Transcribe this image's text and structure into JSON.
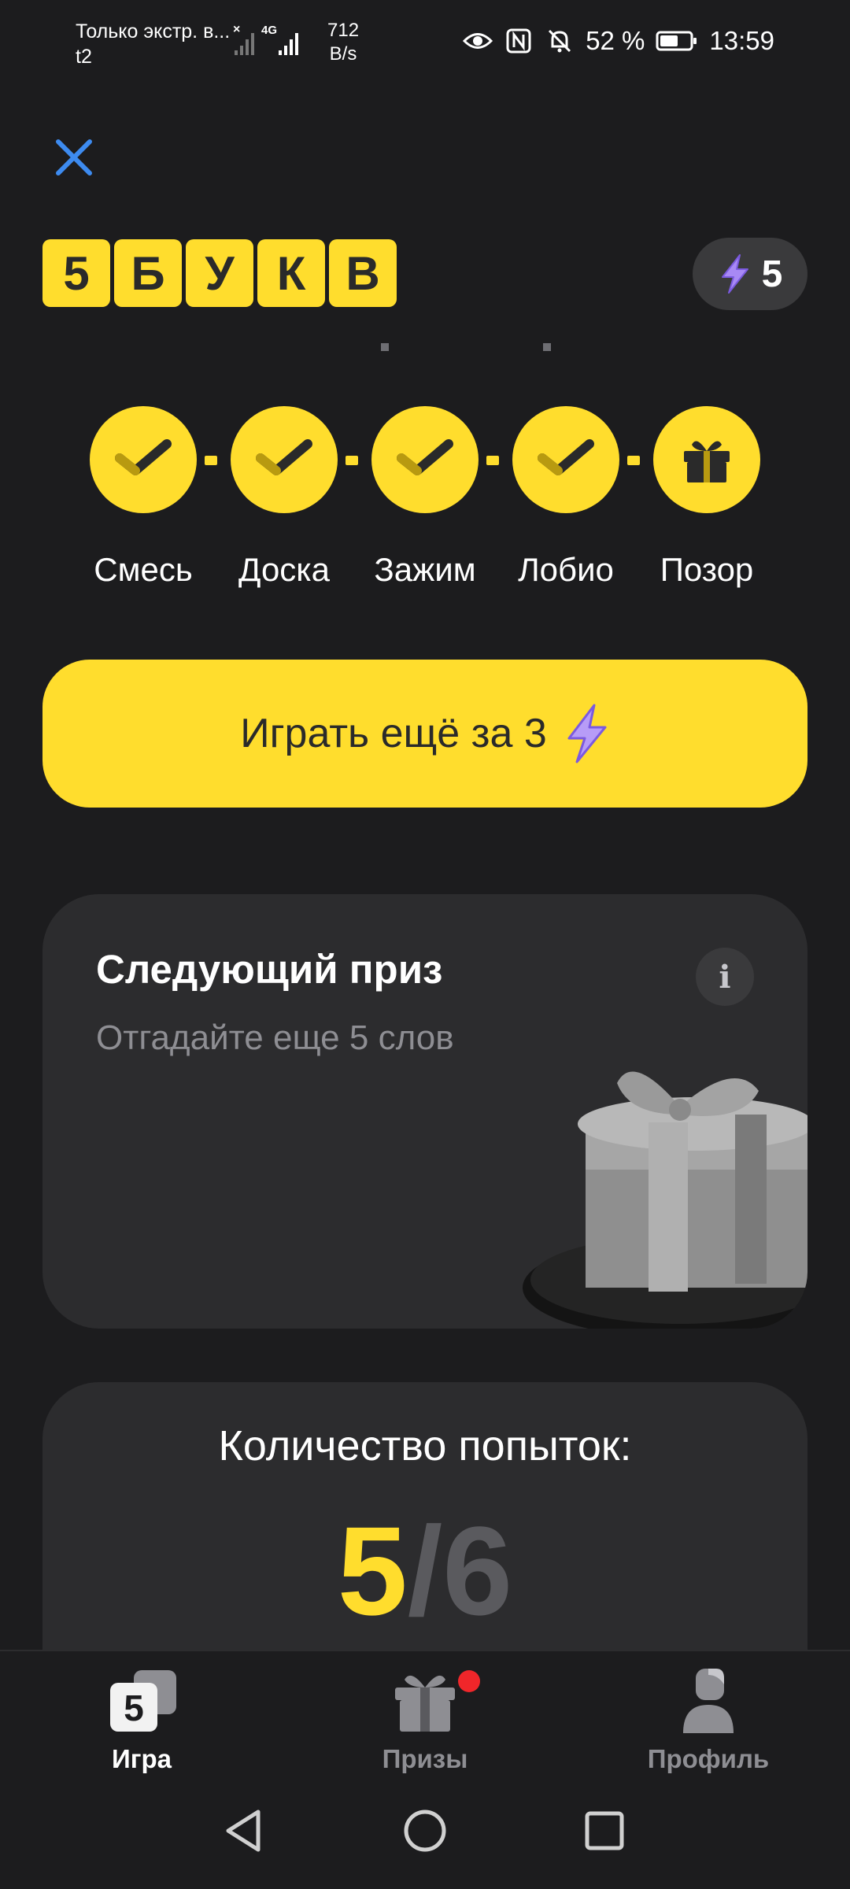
{
  "status_bar": {
    "carrier_line1": "Только экстр. в...",
    "carrier_line2": "t2",
    "network": "4G",
    "speed_value": "712",
    "speed_unit": "B/s",
    "battery": "52 %",
    "time": "13:59",
    "icons": [
      "eye-icon",
      "nfc-icon",
      "bell-off-icon",
      "battery-icon"
    ]
  },
  "header": {
    "logo_letters": [
      "5",
      "Б",
      "У",
      "К",
      "В"
    ],
    "energy_count": "5"
  },
  "progress": {
    "steps": [
      {
        "label": "Смесь",
        "icon": "check-icon",
        "done": true
      },
      {
        "label": "Доска",
        "icon": "check-icon",
        "done": true
      },
      {
        "label": "Зажим",
        "icon": "check-icon",
        "done": true
      },
      {
        "label": "Лобио",
        "icon": "check-icon",
        "done": true
      },
      {
        "label": "Позор",
        "icon": "gift-icon",
        "done": true
      }
    ]
  },
  "play_button": {
    "label": "Играть ещё за 3",
    "icon": "lightning-icon"
  },
  "prize_card": {
    "title": "Следующий приз",
    "subtitle": "Отгадайте еще 5 слов",
    "info_glyph": "i"
  },
  "attempts_card": {
    "title": "Количество попыток:",
    "current": "5",
    "separator": "/",
    "max": "6"
  },
  "bottom_nav": {
    "items": [
      {
        "label": "Игра",
        "icon": "game-icon",
        "active": true
      },
      {
        "label": "Призы",
        "icon": "gift-icon",
        "active": false,
        "badge": true
      },
      {
        "label": "Профиль",
        "icon": "profile-icon",
        "active": false
      }
    ]
  },
  "colors": {
    "accent": "#ffdd2d",
    "background": "#1c1c1e",
    "card": "#2c2c2e",
    "badge": "#f0262a",
    "close": "#3d8bf0"
  }
}
